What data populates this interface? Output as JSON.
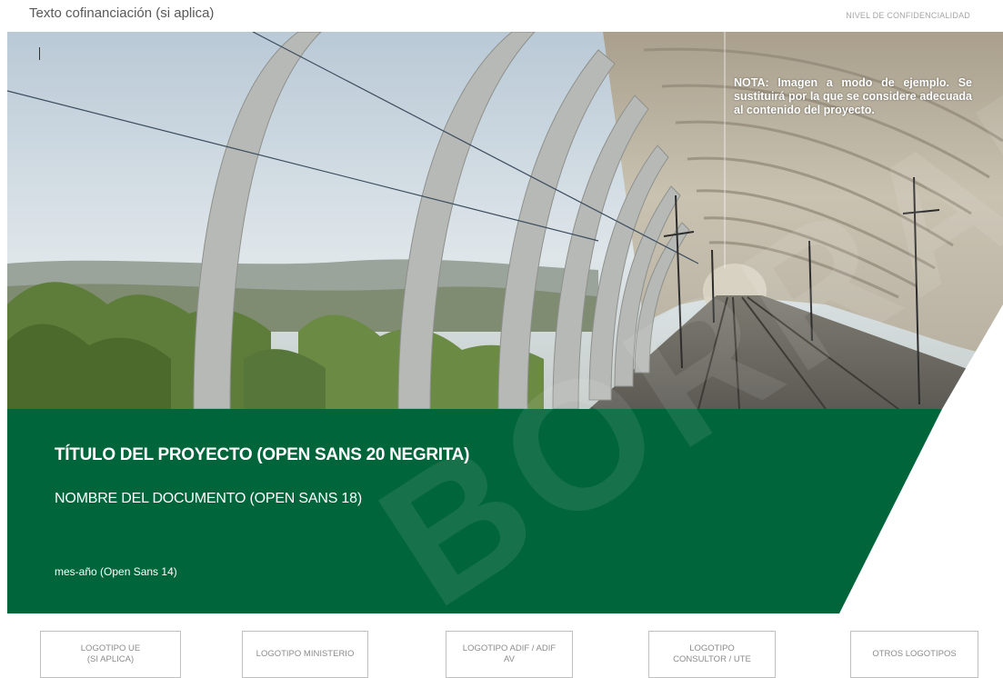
{
  "header": {
    "cofinancing_text": "Texto cofinanciación (si aplica)",
    "confidentiality_level": "NIVEL DE CONFIDENCIALIDAD"
  },
  "cover": {
    "note": "NOTA: Imagen a modo de ejemplo. Se sustituirá por la que se considere adecuada al contenido del proyecto.",
    "project_title": "TÍTULO DEL PROYECTO (OPEN SANS 20 NEGRITA)",
    "document_name": "NOMBRE DEL DOCUMENTO (OPEN SANS 18)",
    "date": "mes-año (Open Sans 14)",
    "watermark": "BORRADOR",
    "green_color": "#00653a"
  },
  "logos": [
    {
      "label": "LOGOTIPO UE\n(SI APLICA)"
    },
    {
      "label": "LOGOTIPO MINISTERIO"
    },
    {
      "label": "LOGOTIPO ADIF / ADIF\nAV"
    },
    {
      "label": "LOGOTIPO\nCONSULTOR / UTE"
    },
    {
      "label": "OTROS LOGOTIPOS"
    }
  ]
}
